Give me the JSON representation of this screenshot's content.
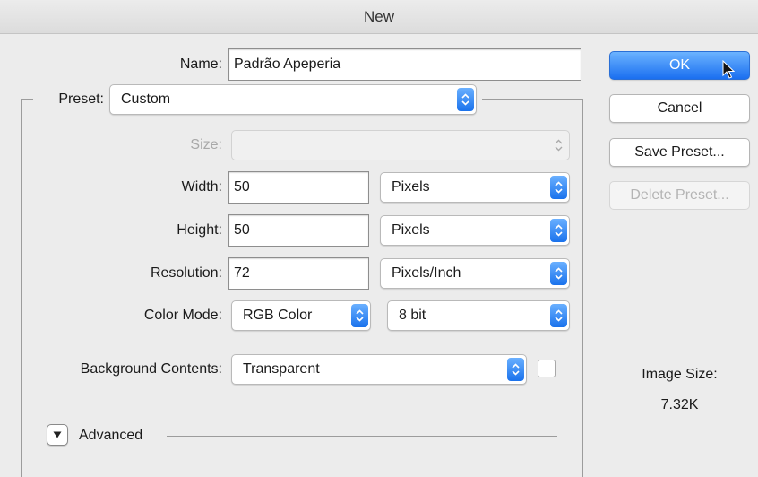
{
  "window": {
    "title": "New"
  },
  "name": {
    "label": "Name:",
    "value": "Padrão Apeperia"
  },
  "preset": {
    "label": "Preset:",
    "value": "Custom"
  },
  "size": {
    "label": "Size:",
    "value": ""
  },
  "width": {
    "label": "Width:",
    "value": "50",
    "unit": "Pixels"
  },
  "height": {
    "label": "Height:",
    "value": "50",
    "unit": "Pixels"
  },
  "resolution": {
    "label": "Resolution:",
    "value": "72",
    "unit": "Pixels/Inch"
  },
  "color_mode": {
    "label": "Color Mode:",
    "value": "RGB Color",
    "depth": "8 bit"
  },
  "background": {
    "label": "Background Contents:",
    "value": "Transparent",
    "checked": false
  },
  "advanced": {
    "label": "Advanced"
  },
  "buttons": {
    "ok": "OK",
    "cancel": "Cancel",
    "save_preset": "Save Preset...",
    "delete_preset": "Delete Preset..."
  },
  "image_size": {
    "label": "Image Size:",
    "value": "7.32K"
  },
  "colors": {
    "accent": "#1a72ec",
    "window_bg": "#ececec"
  }
}
